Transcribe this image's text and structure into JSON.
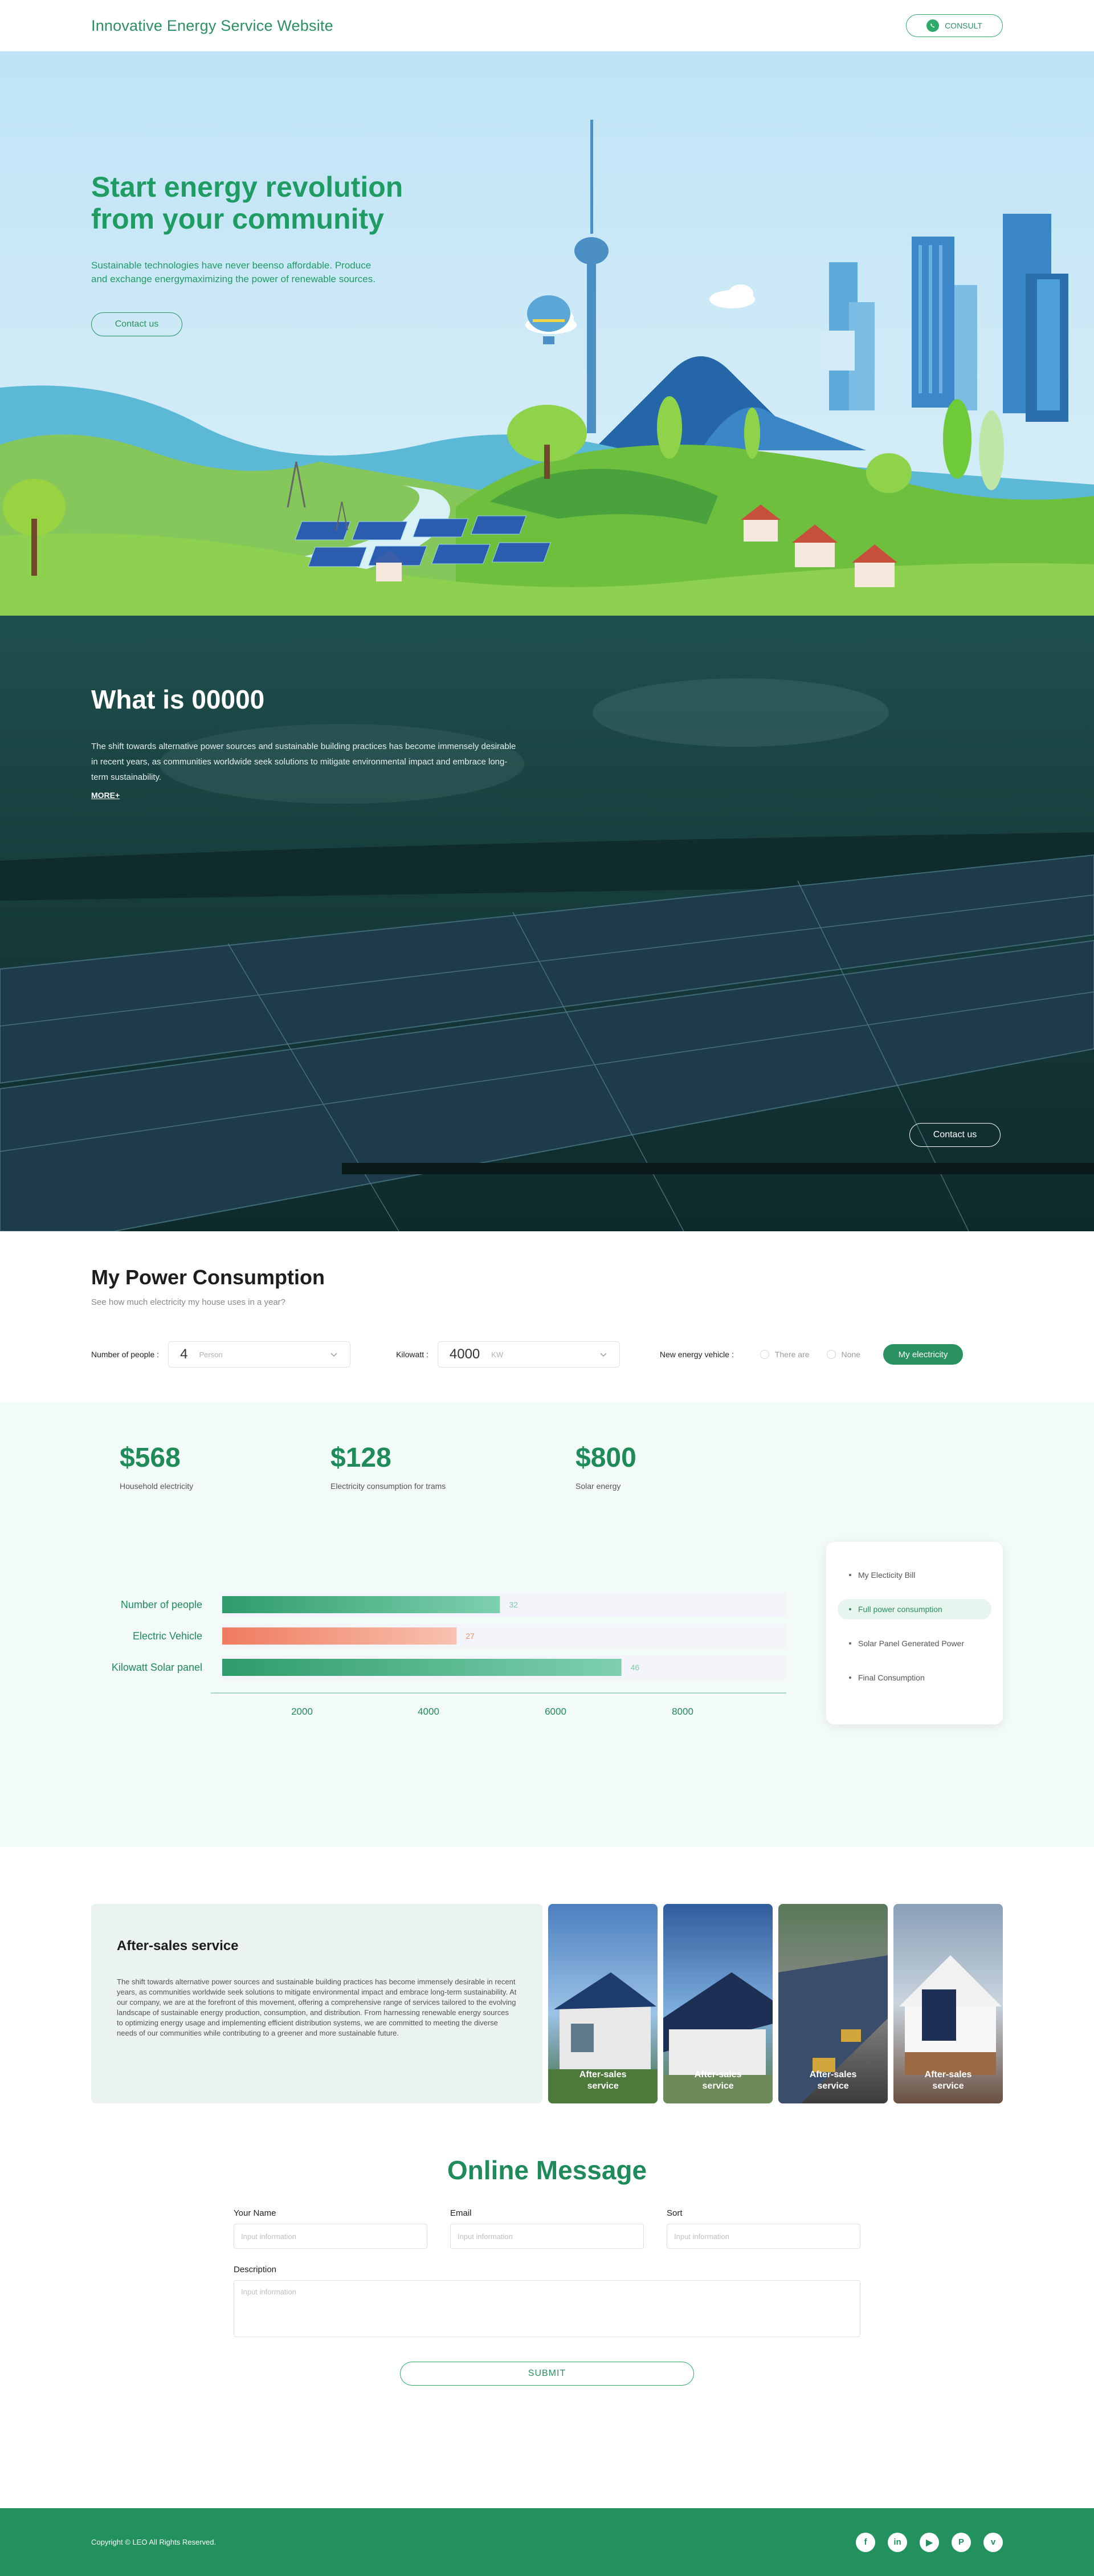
{
  "header": {
    "brand": "Innovative Energy Service Website",
    "consult_label": "CONSULT"
  },
  "hero": {
    "title": "Start energy revolution from your community",
    "subtitle": "Sustainable technologies have never beenso affordable. Produce and exchange energymaximizing the power of renewable sources.",
    "contact_label": "Contact us"
  },
  "whatis": {
    "title": "What is 00000",
    "body": "The shift towards alternative power sources and sustainable building practices has become immensely desirable in recent years, as communities worldwide seek solutions to mitigate environmental impact and embrace long-term sustainability.",
    "more_label": "MORE+",
    "contact_label": "Contact us"
  },
  "consumption": {
    "title": "My Power Consumption",
    "subtitle": "See how much electricity my house uses in a year?",
    "people_label": "Number of people :",
    "people_value": "4",
    "people_unit": "Person",
    "kw_label": "Kilowatt :",
    "kw_value": "4000",
    "kw_unit": "KW",
    "vehicle_label": "New energy vehicle :",
    "radio_options": [
      "There are",
      "None"
    ],
    "my_electricity_label": "My electricity"
  },
  "results": {
    "stats": [
      {
        "value": "$568",
        "label": "Household electricity"
      },
      {
        "value": "$128",
        "label": "Electricity consumption for trams"
      },
      {
        "value": "$800",
        "label": "Solar energy"
      }
    ],
    "side_menu": [
      {
        "label": "My Electicity Bill",
        "active": false
      },
      {
        "label": "Full power consumption",
        "active": true
      },
      {
        "label": "Solar Panel Generated Power",
        "active": false
      },
      {
        "label": "Final Consumption",
        "active": false
      }
    ]
  },
  "chart_data": {
    "type": "bar",
    "orientation": "horizontal",
    "categories": [
      "Number of people",
      "Electric Vehicle",
      "Kilowatt Solar panel"
    ],
    "values": [
      32,
      27,
      46
    ],
    "x_ticks": [
      "2000",
      "4000",
      "6000",
      "8000"
    ],
    "colors": [
      "#2e9c6a",
      "#ef8a6b",
      "#2e9c6a"
    ],
    "grid": false
  },
  "service": {
    "title": "After-sales service",
    "body": "The shift towards alternative power sources and sustainable building practices has become immensely desirable in recent years, as communities worldwide seek solutions to mitigate environmental impact and embrace long-term sustainability.   At our company, we are at the forefront of this movement, offering a comprehensive range of services tailored to the evolving landscape of sustainable energy production, consumption, and distribution.   From harnessing renewable energy sources to optimizing energy usage and implementing efficient distribution systems, we are committed to meeting the diverse needs of our communities while contributing to a greener and more sustainable future.",
    "tiles": [
      "After-sales service",
      "After-sales service",
      "After-sales service",
      "After-sales service"
    ]
  },
  "message": {
    "title": "Online Message",
    "name_label": "Your Name",
    "email_label": "Email",
    "sort_label": "Sort",
    "description_label": "Description",
    "placeholder": "Input information",
    "submit_label": "SUBMIT"
  },
  "footer": {
    "copyright": "Copyright © LEO All Rights Reserved.",
    "socials": [
      "f",
      "in",
      "▶",
      "P",
      "v"
    ]
  },
  "colors": {
    "brand": "#2a9160",
    "accent": "#2eab6a",
    "orange": "#ef8a6b",
    "footer": "#22915e"
  }
}
